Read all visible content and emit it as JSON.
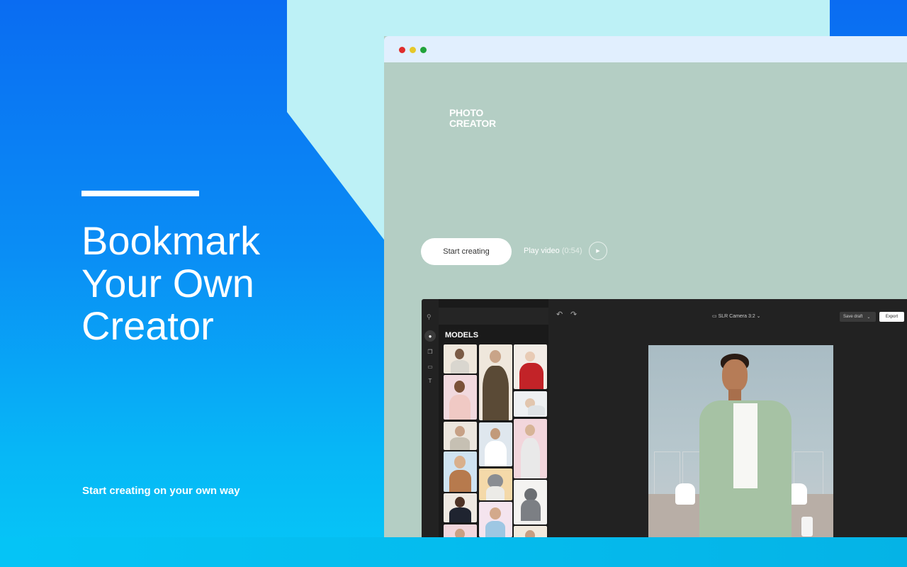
{
  "hero": {
    "title": "Bookmark\nYour Own\nCreator",
    "subtitle": "Start creating on your own way"
  },
  "site": {
    "logo": "PHOTO\nCREATOR",
    "start_button": "Start creating",
    "play_label": "Play video",
    "play_duration": "(0:54)",
    "play_icon": "play-icon"
  },
  "editor": {
    "panel_title": "MODELS",
    "camera": "SLR Camera 3:2",
    "save_draft": "Save draft",
    "export": "Export",
    "rail_icons": [
      "person-icon",
      "layers-icon",
      "image-icon",
      "text-icon"
    ]
  },
  "colors": {
    "brand_blue": "#0a6cf2",
    "accent_cyan": "#bdf1f6",
    "site_bg": "#b4cec4",
    "editor_bg": "#222222"
  }
}
